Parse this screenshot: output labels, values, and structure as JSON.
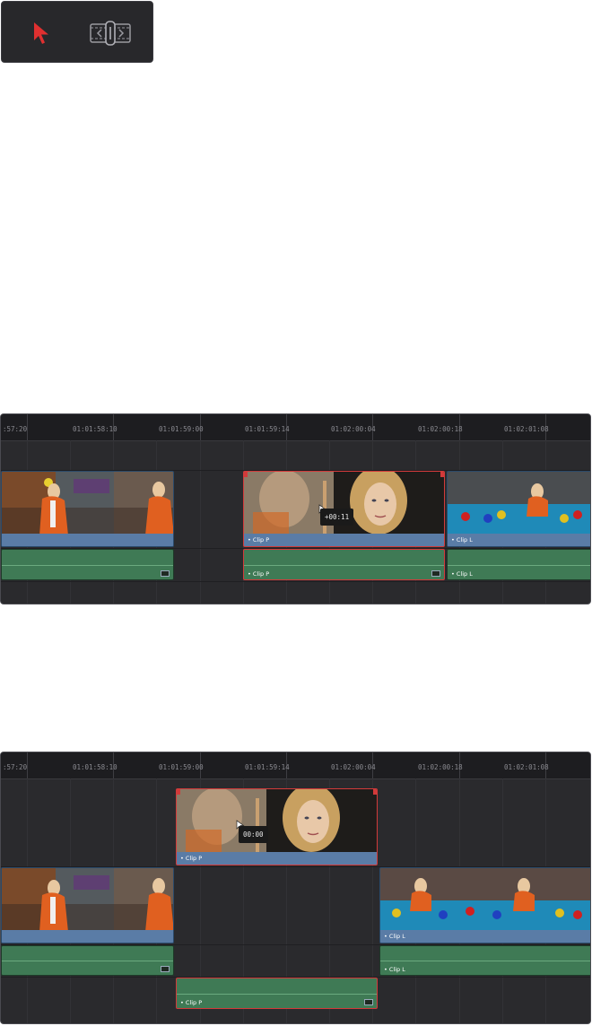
{
  "toolbar": {
    "tools": [
      {
        "name": "selection-mode",
        "icon": "arrow-pointer-icon",
        "color": "#e03030",
        "active": true
      },
      {
        "name": "slip-mode",
        "icon": "slip-slide-icon",
        "color": "#9a9aa0",
        "active": false
      }
    ]
  },
  "ruler": {
    "timecodes": [
      ":57:20",
      "01:01:58:10",
      "01:01:59:00",
      "01:01:59:14",
      "01:02:00:04",
      "01:02:00:18",
      "01:02:01:08"
    ]
  },
  "timeline1": {
    "tooltip": "+00:11",
    "clips": {
      "left_video": "",
      "p_video": "Clip P",
      "l_video": "Clip L",
      "left_audio": "",
      "p_audio": "Clip P",
      "l_audio": "Clip L"
    }
  },
  "timeline2": {
    "tooltip": "00:00",
    "clips": {
      "p_video": "Clip P",
      "left_video": "",
      "l_video": "Clip L",
      "left_audio": "",
      "l_audio": "Clip L",
      "p_audio": "Clip P"
    }
  },
  "colors": {
    "selection_border": "#d23a3a",
    "video_clip": "#5a7ca6",
    "audio_clip": "#3f7a55",
    "panel_bg": "#2a2a2d"
  }
}
